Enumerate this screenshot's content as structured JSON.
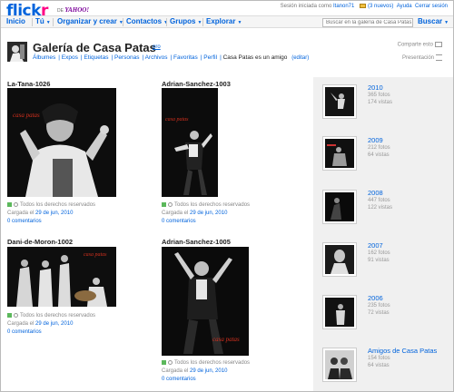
{
  "header": {
    "logo_fl": "fl",
    "logo_ickr": "ick",
    "logo_r": "r",
    "by_text": "DE",
    "yahoo_text": "YAHOO!",
    "session_text": "Sesión iniciada como",
    "username": "Itanon71",
    "mail_count": "(3 nuevos)",
    "help": "Ayuda",
    "logout": "Cerrar sesión"
  },
  "nav": {
    "items": [
      "Inicio",
      "Tú",
      "Organizar y crear",
      "Contactos",
      "Grupos",
      "Explorar"
    ],
    "search_placeholder": "Buscar en la galería de Casa Patas",
    "search_button": "Buscar"
  },
  "profile": {
    "title": "Galería de Casa Patas",
    "pro": "pro",
    "subnav": [
      "Álbumes",
      "Expos",
      "Etiquetas",
      "Personas",
      "Archivos",
      "Favoritas",
      "Perfil"
    ],
    "friend_text": "Casa Patas es un amigo",
    "edit": "(editar)",
    "share": "Comparte esto",
    "slideshow": "Presentación"
  },
  "photos": [
    {
      "title": "La-Tana-1026",
      "license": "Todos los derechos reservados",
      "uploaded_prefix": "Cargada el",
      "date": "29 de jun, 2010",
      "comments": "0 comentarios",
      "brand": "casa patas"
    },
    {
      "title": "Adrian-Sanchez-1003",
      "license": "Todos los derechos reservados",
      "uploaded_prefix": "Cargada el",
      "date": "29 de jun, 2010",
      "comments": "0 comentarios",
      "brand": "casa patas"
    },
    {
      "title": "Dani-de-Moron-1002",
      "license": "Todos los derechos reservados",
      "uploaded_prefix": "Cargada el",
      "date": "29 de jun, 2010",
      "comments": "0 comentarios",
      "brand": "casa patas"
    },
    {
      "title": "Adrian-Sanchez-1005",
      "license": "Todos los derechos reservados",
      "uploaded_prefix": "Cargada el",
      "date": "29 de jun, 2010",
      "comments": "0 comentarios",
      "brand": "casa patas"
    }
  ],
  "sets": [
    {
      "name": "2010",
      "photos": "365 fotos",
      "views": "174 vistas"
    },
    {
      "name": "2009",
      "photos": "212 fotos",
      "views": "64 vistas"
    },
    {
      "name": "2008",
      "photos": "447 fotos",
      "views": "122 vistas"
    },
    {
      "name": "2007",
      "photos": "162 fotos",
      "views": "91 vistas"
    },
    {
      "name": "2006",
      "photos": "235 fotos",
      "views": "72 vistas"
    },
    {
      "name": "Amigos de Casa Patas",
      "photos": "154 fotos",
      "views": "64 vistas"
    }
  ],
  "colors": {
    "brand_blue": "#0063dc",
    "brand_pink": "#ff0084",
    "watermark_red": "#d2301e"
  }
}
